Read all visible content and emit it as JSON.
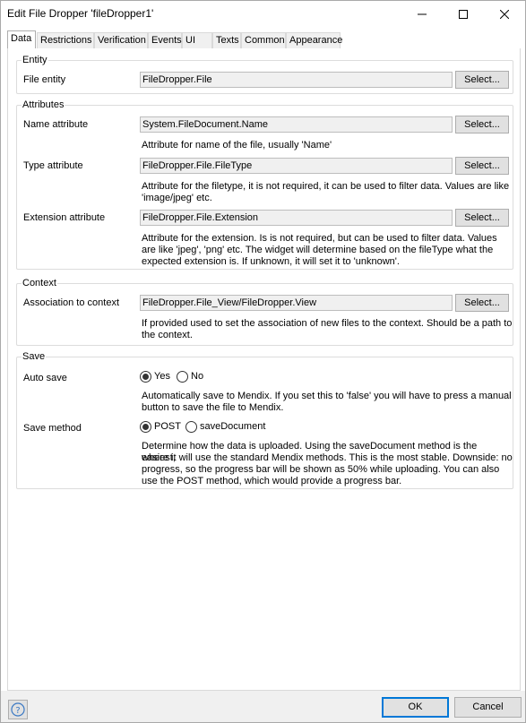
{
  "window": {
    "title": "Edit File Dropper 'fileDropper1'"
  },
  "tabs": [
    {
      "label": "Data",
      "active": true
    },
    {
      "label": "Restrictions",
      "active": false
    },
    {
      "label": "Verification",
      "active": false
    },
    {
      "label": "Events",
      "active": false
    },
    {
      "label": "UI",
      "active": false
    },
    {
      "label": "Texts",
      "active": false
    },
    {
      "label": "Common",
      "active": false
    },
    {
      "label": "Appearance",
      "active": false
    }
  ],
  "entity": {
    "group_title": "Entity",
    "file_entity_label": "File entity",
    "file_entity_value": "FileDropper.File",
    "select_label": "Select..."
  },
  "attributes": {
    "group_title": "Attributes",
    "name_label": "Name attribute",
    "name_value": "System.FileDocument.Name",
    "name_help": "Attribute for name of the file, usually 'Name'",
    "type_label": "Type attribute",
    "type_value": "FileDropper.File.FileType",
    "type_help_1": "Attribute for the filetype, it is not required, it can be used to filter data. Values are like",
    "type_help_2": "'image/jpeg' etc.",
    "ext_label": "Extension attribute",
    "ext_value": "FileDropper.File.Extension",
    "ext_help_1": "Attribute for the extension. Is is not required, but can be used to filter data. Values",
    "ext_help_2": "are like 'jpeg', 'png' etc. The widget will determine based on the fileType what the",
    "ext_help_3": "expected extension is. If unknown, it will set it to 'unknown'.",
    "select_label": "Select..."
  },
  "context": {
    "group_title": "Context",
    "assoc_label": "Association to context",
    "assoc_value": "FileDropper.File_View/FileDropper.View",
    "assoc_help_1": "If provided used to set the association of new files to the context. Should be a path to",
    "assoc_help_2": "the context.",
    "select_label": "Select..."
  },
  "save": {
    "group_title": "Save",
    "auto_save_label": "Auto save",
    "auto_save_options": [
      {
        "label": "Yes",
        "selected": true
      },
      {
        "label": "No",
        "selected": false
      }
    ],
    "auto_save_help_1": "Automatically save to Mendix. If you set this to 'false' you will have to press a manual",
    "auto_save_help_2": "button to save the file to Mendix.",
    "method_label": "Save method",
    "method_options": [
      {
        "label": "POST",
        "selected": true
      },
      {
        "label": "saveDocument",
        "selected": false
      }
    ],
    "method_help_1": "Determine how the data is uploaded. Using the saveDocument method is the easiest,",
    "method_help_2": "where it will use the standard Mendix methods. This is the most stable. Downside: no",
    "method_help_3": "progress, so the progress bar will be shown as 50% while uploading. You can also",
    "method_help_4": "use the POST method, which would provide a progress bar."
  },
  "footer": {
    "help_icon": "question-icon",
    "ok_label": "OK",
    "cancel_label": "Cancel"
  },
  "colors": {
    "accent": "#0078d7",
    "button_bg": "#e1e1e1",
    "field_bg": "#f0f0f0"
  }
}
